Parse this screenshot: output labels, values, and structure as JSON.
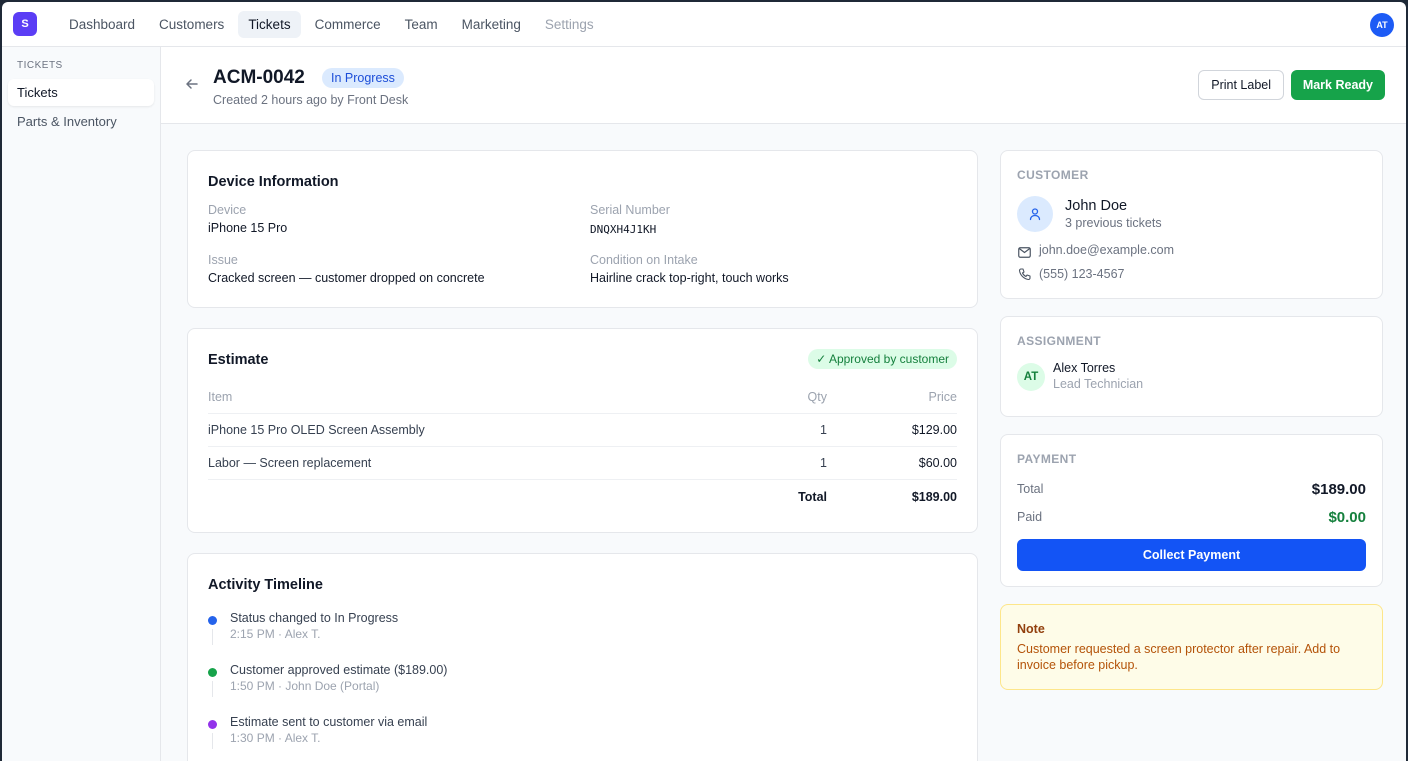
{
  "topnav": {
    "logo": "S",
    "items": [
      "Dashboard",
      "Customers",
      "Tickets",
      "Commerce",
      "Team",
      "Marketing",
      "Settings"
    ],
    "avatar": "AT"
  },
  "sidebar": {
    "section": "TICKETS",
    "items": [
      "Tickets",
      "Parts & Inventory"
    ]
  },
  "header": {
    "back_icon": "arrow-left-icon",
    "ticket_id": "ACM-0042",
    "status": "In Progress",
    "created": "Created 2 hours ago by Front Desk",
    "print_label": "Print Label",
    "mark_ready": "Mark Ready"
  },
  "device": {
    "title": "Device Information",
    "device_label": "Device",
    "device_value": "iPhone 15 Pro",
    "serial_label": "Serial Number",
    "serial_value": "DNQXH4J1KH",
    "issue_label": "Issue",
    "issue_value": "Cracked screen — customer dropped on concrete",
    "condition_label": "Condition on Intake",
    "condition_value": "Hairline crack top-right, touch works"
  },
  "estimate": {
    "title": "Estimate",
    "approved": "Approved by customer",
    "headers": {
      "item": "Item",
      "qty": "Qty",
      "price": "Price"
    },
    "rows": [
      {
        "item": "iPhone 15 Pro OLED Screen Assembly",
        "qty": "1",
        "price": "$129.00"
      },
      {
        "item": "Labor — Screen replacement",
        "qty": "1",
        "price": "$60.00"
      }
    ],
    "total_label": "Total",
    "total_value": "$189.00"
  },
  "timeline": {
    "title": "Activity Timeline",
    "events": [
      {
        "text": "Status changed to In Progress",
        "time": "2:15 PM · Alex T.",
        "color": "#2563eb"
      },
      {
        "text": "Customer approved estimate ($189.00)",
        "time": "1:50 PM · John Doe (Portal)",
        "color": "#16a34a"
      },
      {
        "text": "Estimate sent to customer via email",
        "time": "1:30 PM · Alex T.",
        "color": "#9333ea"
      }
    ]
  },
  "customer": {
    "section": "CUSTOMER",
    "name": "John Doe",
    "history": "3 previous tickets",
    "email": "john.doe@example.com",
    "phone": "(555) 123-4567"
  },
  "assignment": {
    "section": "ASSIGNMENT",
    "initials": "AT",
    "name": "Alex Torres",
    "role": "Lead Technician"
  },
  "payment": {
    "section": "PAYMENT",
    "total_label": "Total",
    "total_value": "$189.00",
    "paid_label": "Paid",
    "paid_value": "$0.00",
    "collect": "Collect Payment"
  },
  "note": {
    "title": "Note",
    "text": "Customer requested a screen protector after repair. Add to invoice before pickup."
  },
  "colors": {
    "accent": "#1354f5",
    "success": "#16a34a",
    "brand": "#5b3df5"
  }
}
